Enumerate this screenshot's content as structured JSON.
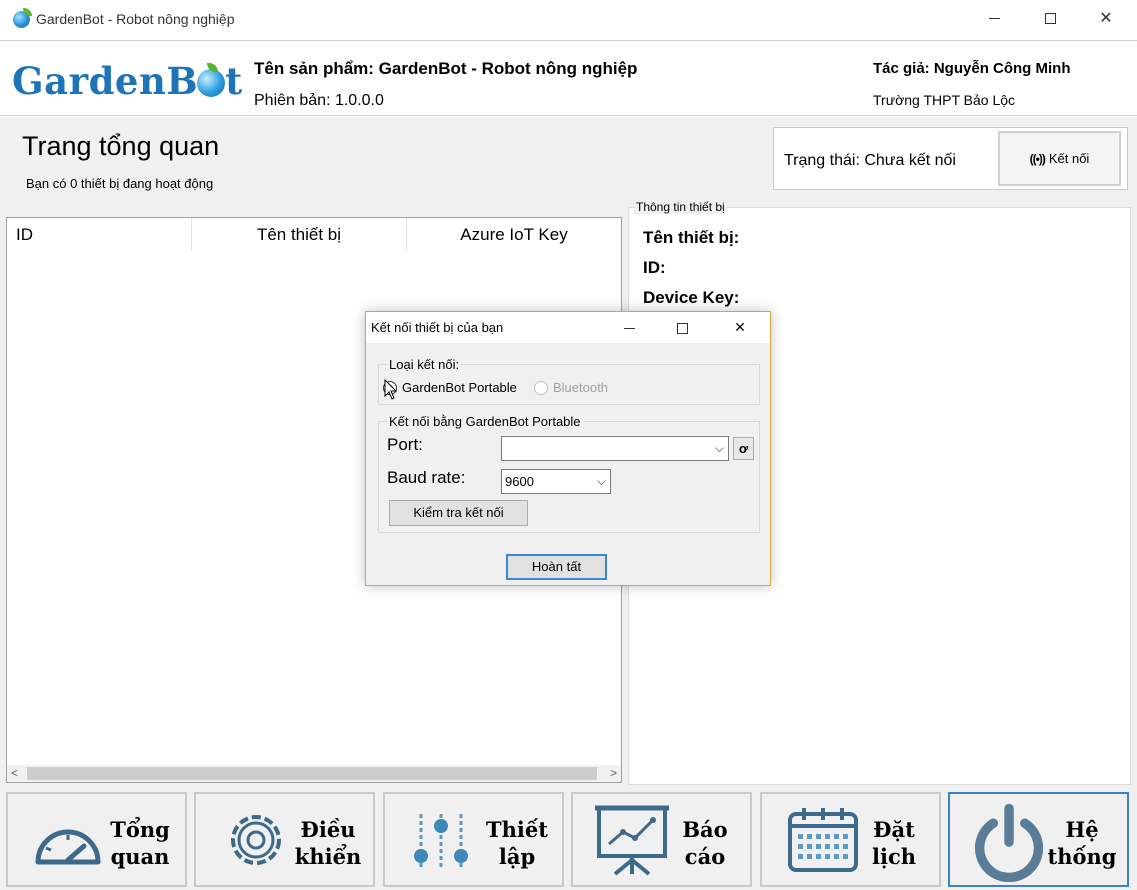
{
  "window": {
    "title": "GardenBot - Robot nông nghiệp"
  },
  "header": {
    "logo": "GardenBot",
    "product": "Tên sản phẩm: GardenBot - Robot nông nghiệp",
    "version": "Phiên bản: 1.0.0.0",
    "author": "Tác giả: Nguyễn Công Minh",
    "school": "Trường THPT Bảo Lộc"
  },
  "page": {
    "title": "Trang tổng quan",
    "subtitle": "Bạn có 0 thiết bị đang hoạt động"
  },
  "status": {
    "text": "Trạng thái: Chưa kết nối",
    "connect_label": "Kết nối",
    "connect_icon": "((•))"
  },
  "device_table": {
    "columns": [
      "ID",
      "Tên thiết bị",
      "Azure IoT Key"
    ],
    "rows": []
  },
  "device_info": {
    "legend": "Thông tin thiết bị",
    "name_label": "Tên thiết bị:",
    "id_label": "ID:",
    "key_label": "Device Key:"
  },
  "nav": [
    {
      "label_1": "Tổng",
      "label_2": "quan",
      "icon": "gauge-icon"
    },
    {
      "label_1": "Điều",
      "label_2": "khiển",
      "icon": "gear-icon"
    },
    {
      "label_1": "Thiết",
      "label_2": "lập",
      "icon": "sliders-icon"
    },
    {
      "label_1": "Báo",
      "label_2": "cáo",
      "icon": "presentation-chart-icon"
    },
    {
      "label_1": "Đặt",
      "label_2": "lịch",
      "icon": "calendar-icon"
    },
    {
      "label_1": "Hệ",
      "label_2": "thống",
      "icon": "power-icon"
    }
  ],
  "dialog": {
    "title": "Kết nối thiết bị của bạn",
    "conn_type_legend": "Loại kết nối:",
    "option_portable": "GardenBot Portable",
    "option_bluetooth": "Bluetooth",
    "portable_legend": "Kết nối bằng GardenBot Portable",
    "port_label": "Port:",
    "port_value": "",
    "baud_label": "Baud rate:",
    "baud_value": "9600",
    "refresh_icon": "ơ",
    "test_label": "Kiểm tra kết nối",
    "done_label": "Hoàn tất"
  },
  "colors": {
    "accent": "#3a82c9",
    "icon": "#3d6a8a",
    "brand": "#1f74b8"
  }
}
